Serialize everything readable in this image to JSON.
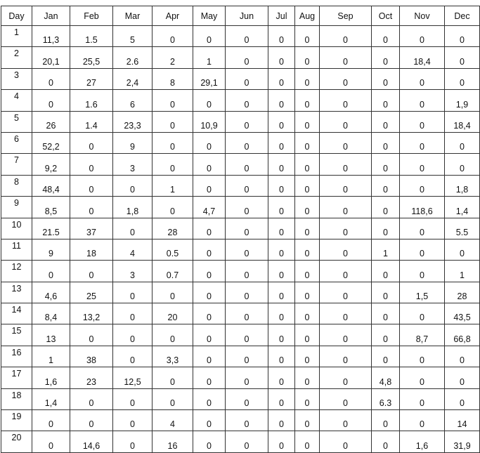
{
  "table": {
    "headers": [
      "Day",
      "Jan",
      "Feb",
      "Mar",
      "Apr",
      "May",
      "Jun",
      "Jul",
      "Aug",
      "Sep",
      "Oct",
      "Nov",
      "Dec"
    ],
    "rows": [
      [
        "1",
        "11,3",
        "1.5",
        "5",
        "0",
        "0",
        "0",
        "0",
        "0",
        "0",
        "0",
        "0",
        "0"
      ],
      [
        "2",
        "20,1",
        "25,5",
        "2.6",
        "2",
        "1",
        "0",
        "0",
        "0",
        "0",
        "0",
        "18,4",
        "0"
      ],
      [
        "3",
        "0",
        "27",
        "2,4",
        "8",
        "29,1",
        "0",
        "0",
        "0",
        "0",
        "0",
        "0",
        "0"
      ],
      [
        "4",
        "0",
        "1.6",
        "6",
        "0",
        "0",
        "0",
        "0",
        "0",
        "0",
        "0",
        "0",
        "1,9"
      ],
      [
        "5",
        "26",
        "1.4",
        "23,3",
        "0",
        "10,9",
        "0",
        "0",
        "0",
        "0",
        "0",
        "0",
        "18,4"
      ],
      [
        "6",
        "52,2",
        "0",
        "9",
        "0",
        "0",
        "0",
        "0",
        "0",
        "0",
        "0",
        "0",
        "0"
      ],
      [
        "7",
        "9,2",
        "0",
        "3",
        "0",
        "0",
        "0",
        "0",
        "0",
        "0",
        "0",
        "0",
        "0"
      ],
      [
        "8",
        "48,4",
        "0",
        "0",
        "1",
        "0",
        "0",
        "0",
        "0",
        "0",
        "0",
        "0",
        "1,8"
      ],
      [
        "9",
        "8,5",
        "0",
        "1,8",
        "0",
        "4,7",
        "0",
        "0",
        "0",
        "0",
        "0",
        "118,6",
        "1,4"
      ],
      [
        "10",
        "21.5",
        "37",
        "0",
        "28",
        "0",
        "0",
        "0",
        "0",
        "0",
        "0",
        "0",
        "5.5"
      ],
      [
        "11",
        "9",
        "18",
        "4",
        "0.5",
        "0",
        "0",
        "0",
        "0",
        "0",
        "1",
        "0",
        "0"
      ],
      [
        "12",
        "0",
        "0",
        "3",
        "0.7",
        "0",
        "0",
        "0",
        "0",
        "0",
        "0",
        "0",
        "1"
      ],
      [
        "13",
        "4,6",
        "25",
        "0",
        "0",
        "0",
        "0",
        "0",
        "0",
        "0",
        "0",
        "1,5",
        "28"
      ],
      [
        "14",
        "8,4",
        "13,2",
        "0",
        "20",
        "0",
        "0",
        "0",
        "0",
        "0",
        "0",
        "0",
        "43,5"
      ],
      [
        "15",
        "13",
        "0",
        "0",
        "0",
        "0",
        "0",
        "0",
        "0",
        "0",
        "0",
        "8,7",
        "66,8"
      ],
      [
        "16",
        "1",
        "38",
        "0",
        "3,3",
        "0",
        "0",
        "0",
        "0",
        "0",
        "0",
        "0",
        "0"
      ],
      [
        "17",
        "1,6",
        "23",
        "12,5",
        "0",
        "0",
        "0",
        "0",
        "0",
        "0",
        "4,8",
        "0",
        "0"
      ],
      [
        "18",
        "1,4",
        "0",
        "0",
        "0",
        "0",
        "0",
        "0",
        "0",
        "0",
        "6.3",
        "0",
        "0"
      ],
      [
        "19",
        "0",
        "0",
        "0",
        "4",
        "0",
        "0",
        "0",
        "0",
        "0",
        "0",
        "0",
        "14"
      ],
      [
        "20",
        "0",
        "14,6",
        "0",
        "16",
        "0",
        "0",
        "0",
        "0",
        "0",
        "0",
        "1,6",
        "31,9"
      ]
    ]
  }
}
